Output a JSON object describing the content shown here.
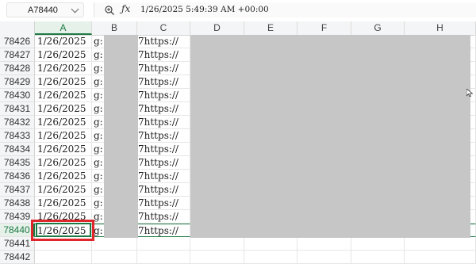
{
  "formula_bar": {
    "name_box": "A78440",
    "formula": "1/26/2025 5:49:39 AM +00:00"
  },
  "columns": [
    "A",
    "B",
    "C",
    "D",
    "E",
    "F",
    "G",
    "H"
  ],
  "rows": [
    {
      "num": "78426",
      "a": "1/26/2025",
      "b": "g:",
      "c": "7https://"
    },
    {
      "num": "78427",
      "a": "1/26/2025",
      "b": "g:",
      "c": "7https://"
    },
    {
      "num": "78428",
      "a": "1/26/2025",
      "b": "g:",
      "c": "7https://"
    },
    {
      "num": "78429",
      "a": "1/26/2025",
      "b": "g:",
      "c": "7https://"
    },
    {
      "num": "78430",
      "a": "1/26/2025",
      "b": "g:",
      "c": "7https://"
    },
    {
      "num": "78431",
      "a": "1/26/2025",
      "b": "g:",
      "c": "7https://"
    },
    {
      "num": "78432",
      "a": "1/26/2025",
      "b": "g:",
      "c": "7https://"
    },
    {
      "num": "78433",
      "a": "1/26/2025",
      "b": "g:",
      "c": "7https://"
    },
    {
      "num": "78434",
      "a": "1/26/2025",
      "b": "g:",
      "c": "7https://"
    },
    {
      "num": "78435",
      "a": "1/26/2025",
      "b": "g:",
      "c": "7https://"
    },
    {
      "num": "78436",
      "a": "1/26/2025",
      "b": "g:",
      "c": "7https://"
    },
    {
      "num": "78437",
      "a": "1/26/2025",
      "b": "g:",
      "c": "7https://"
    },
    {
      "num": "78438",
      "a": "1/26/2025",
      "b": "g:",
      "c": "7https://"
    },
    {
      "num": "78439",
      "a": "1/26/2025",
      "b": "g:",
      "c": "7https://"
    },
    {
      "num": "78440",
      "a": "1/26/2025",
      "b": "g:",
      "c": "7https://"
    },
    {
      "num": "78441",
      "a": "",
      "b": "",
      "c": ""
    },
    {
      "num": "78442",
      "a": "",
      "b": "",
      "c": ""
    }
  ],
  "selected_row": "78440",
  "colors": {
    "accent": "#1e7a45",
    "highlight": "#e0262b",
    "redaction": "#c6c6c6"
  }
}
